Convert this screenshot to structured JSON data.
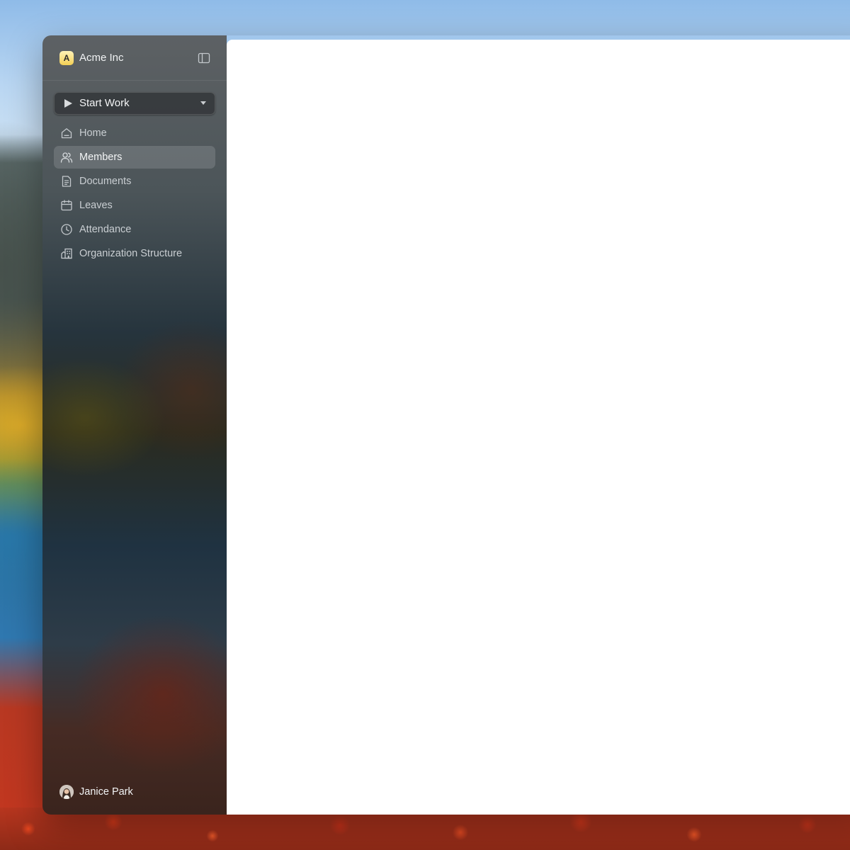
{
  "org": {
    "logo_letter": "A",
    "name": "Acme Inc",
    "collapse_icon": "sidebar-panel-icon"
  },
  "start_work": {
    "label": "Start Work",
    "icon": "play-icon",
    "caret_icon": "caret-down-icon"
  },
  "nav": {
    "items": [
      {
        "label": "Home",
        "icon": "home-icon",
        "active": false
      },
      {
        "label": "Members",
        "icon": "users-icon",
        "active": true
      },
      {
        "label": "Documents",
        "icon": "document-icon",
        "active": false
      },
      {
        "label": "Leaves",
        "icon": "calendar-icon",
        "active": false
      },
      {
        "label": "Attendance",
        "icon": "clock-icon",
        "active": false
      },
      {
        "label": "Organization Structure",
        "icon": "building-icon",
        "active": false
      }
    ]
  },
  "user": {
    "name": "Janice Park",
    "avatar_icon": "avatar"
  },
  "colors": {
    "content_bg": "#ffffff",
    "logo_bg": "#f3cf55",
    "active_item_bg": "rgba(255,255,255,0.14)"
  }
}
